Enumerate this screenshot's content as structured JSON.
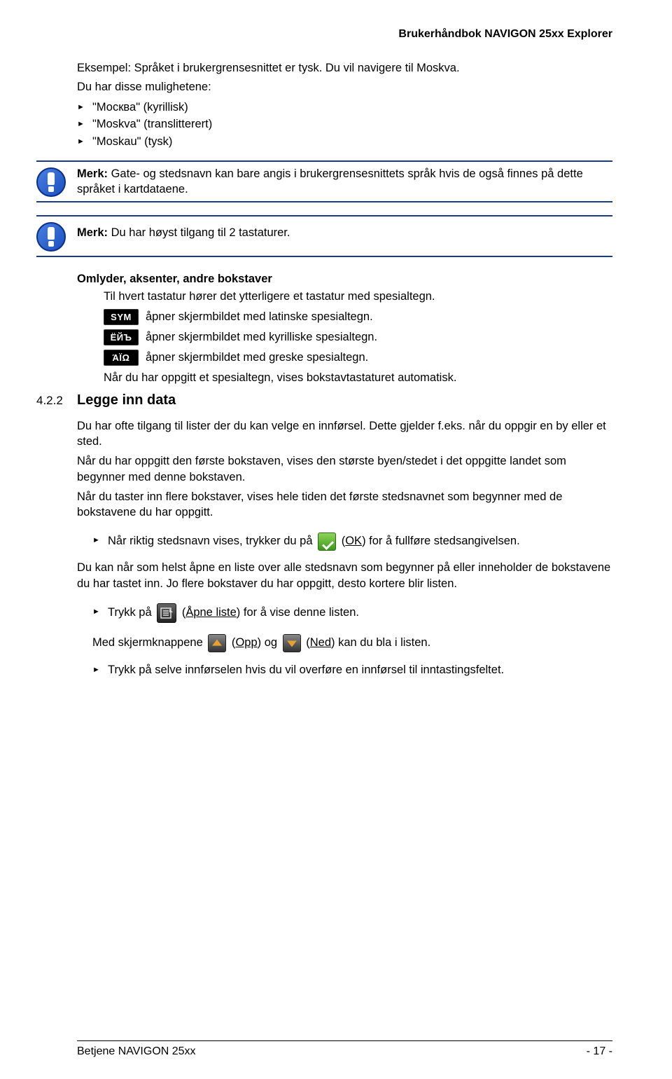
{
  "header": {
    "title": "Brukerhåndbok NAVIGON 25xx Explorer"
  },
  "intro": {
    "example": "Eksempel: Språket i brukergrensesnittet er tysk. Du vil navigere til Moskva.",
    "lead": "Du har disse mulighetene:",
    "items": [
      "\"Москва\" (kyrillisk)",
      "\"Moskva\" (translitterert)",
      "\"Moskau\" (tysk)"
    ]
  },
  "note1": {
    "label": "Merk:",
    "text": " Gate- og stedsnavn kan bare angis i brukergrensesnittets språk hvis de også finnes på dette språket i kartdataene."
  },
  "note2": {
    "label": "Merk:",
    "text": " Du har høyst tilgang til 2 tastaturer."
  },
  "section_omlyder": {
    "heading": "Omlyder, aksenter, andre bokstaver",
    "intro": "Til hvert tastatur hører det ytterligere et tastatur med spesialtegn.",
    "rows": [
      {
        "btn": "SYM",
        "text": " åpner skjermbildet med latinske spesialtegn."
      },
      {
        "btn": "ЁЙЪ",
        "text": " åpner skjermbildet med kyrilliske spesialtegn."
      },
      {
        "btn": "ΆΪΩ",
        "text": " åpner skjermbildet med greske spesialtegn."
      }
    ],
    "outro": "Når du har oppgitt et spesialtegn, vises bokstavtastaturet automatisk."
  },
  "sec422": {
    "num": "4.2.2",
    "title": "Legge inn data",
    "p1": "Du har ofte tilgang til lister der du kan velge en innførsel. Dette gjelder f.eks. når du oppgir en by eller et sted.",
    "p2": "Når du har oppgitt den første bokstaven, vises den største byen/stedet i det oppgitte landet som begynner med denne bokstaven.",
    "p3": "Når du taster inn flere bokstaver, vises hele tiden det første stedsnavnet som begynner med de bokstavene du har oppgitt.",
    "b1_pre": "Når riktig stedsnavn vises, trykker du på ",
    "b1_ok": "OK",
    "b1_post": ") for å fullføre stedsangivelsen.",
    "p4": "Du kan når som helst åpne en liste over alle stedsnavn som begynner på eller inneholder de bokstavene du har tastet inn. Jo flere bokstaver du har oppgitt, desto kortere blir listen.",
    "b2_pre": "Trykk på ",
    "b2_label": "Åpne liste",
    "b2_post": ") for å vise denne listen.",
    "p5_pre": "Med skjermknappene ",
    "p5_up": "Opp",
    "p5_mid": ") og ",
    "p5_down": "Ned",
    "p5_post": ") kan du bla i listen.",
    "b3": "Trykk på selve innførselen hvis du vil overføre en innførsel til inntastingsfeltet."
  },
  "footer": {
    "left": "Betjene NAVIGON 25xx",
    "right": "- 17 -"
  }
}
